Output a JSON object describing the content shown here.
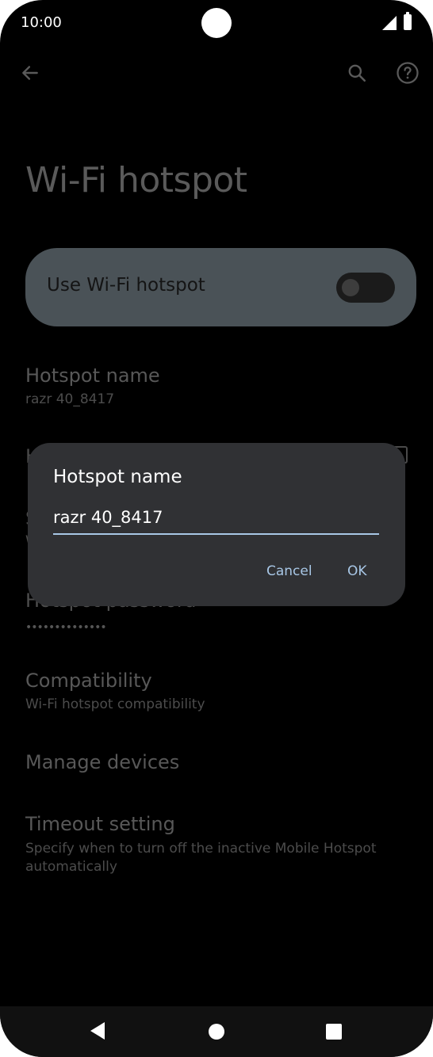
{
  "status_bar": {
    "time": "10:00"
  },
  "page": {
    "title": "Wi-Fi hotspot"
  },
  "master_switch": {
    "label": "Use Wi-Fi hotspot",
    "enabled": false
  },
  "preferences": {
    "hotspot_name": {
      "title": "Hotspot name",
      "summary": "razr 40_8417"
    },
    "hidden_row_1": {
      "title_fragment": "H"
    },
    "hidden_row_2": {
      "title_fragment": "S",
      "summary_fragment": "W"
    },
    "hotspot_password": {
      "title": "Hotspot password",
      "summary": "••••••••••••••"
    },
    "compatibility": {
      "title": "Compatibility",
      "summary": "Wi-Fi hotspot compatibility"
    },
    "manage_devices": {
      "title": "Manage devices"
    },
    "timeout": {
      "title": "Timeout setting",
      "summary": "Specify when to turn off the inactive Mobile Hotspot automatically"
    }
  },
  "dialog": {
    "title": "Hotspot name",
    "input_value": "razr 40_8417",
    "cancel_label": "Cancel",
    "ok_label": "OK"
  },
  "colors": {
    "background": "#000000",
    "dialog": "#303134",
    "accent": "#a8c7e6",
    "master_card": "#4a5257"
  },
  "icons": [
    "back-arrow-icon",
    "search-icon",
    "help-icon",
    "nav-back-icon",
    "nav-home-icon",
    "nav-recents-icon"
  ]
}
